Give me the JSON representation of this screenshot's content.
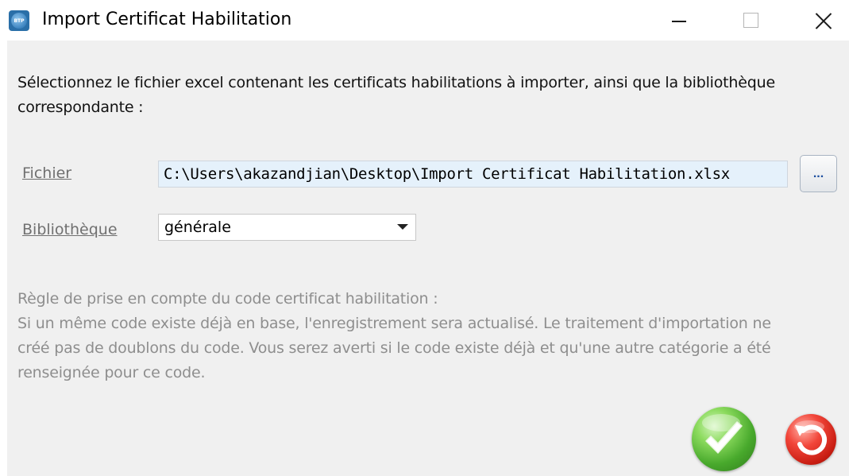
{
  "window": {
    "title": "Import Certificat Habilitation",
    "icon": "app-logo-icon",
    "icon_text": "BTP",
    "controls": [
      "minimize-icon",
      "maximize-icon",
      "close-icon"
    ]
  },
  "intro": {
    "line1": "Sélectionnez le fichier excel contenant les certificats habilitations à importer, ainsi que la bibliothèque",
    "line2": "correspondante :"
  },
  "form": {
    "file_label": "Fichier",
    "file_value": "C:\\Users\\akazandjian\\Desktop\\Import Certificat Habilitation.xlsx",
    "browse_label": "...",
    "library_label": "Bibliothèque",
    "library_value": "générale"
  },
  "rule": {
    "line1": "Règle de prise en compte du code certificat habilitation :",
    "line2": "Si un même code existe déjà en base, l'enregistrement sera actualisé. Le traitement d'importation ne",
    "line3": "créé pas de doublons du code. Vous serez averti si le code existe déjà et qu'une autre catégorie a été",
    "line4": "renseignée pour ce code."
  },
  "actions": {
    "ok_icon": "checkmark-icon",
    "cancel_icon": "undo-icon"
  },
  "colors": {
    "content_bg": "#f0f0f0",
    "input_bg": "#e5f1fb",
    "label_color": "#707070",
    "rule_text": "#8e8e8e",
    "ok_green": "#48a92c",
    "cancel_red": "#d8241a"
  }
}
